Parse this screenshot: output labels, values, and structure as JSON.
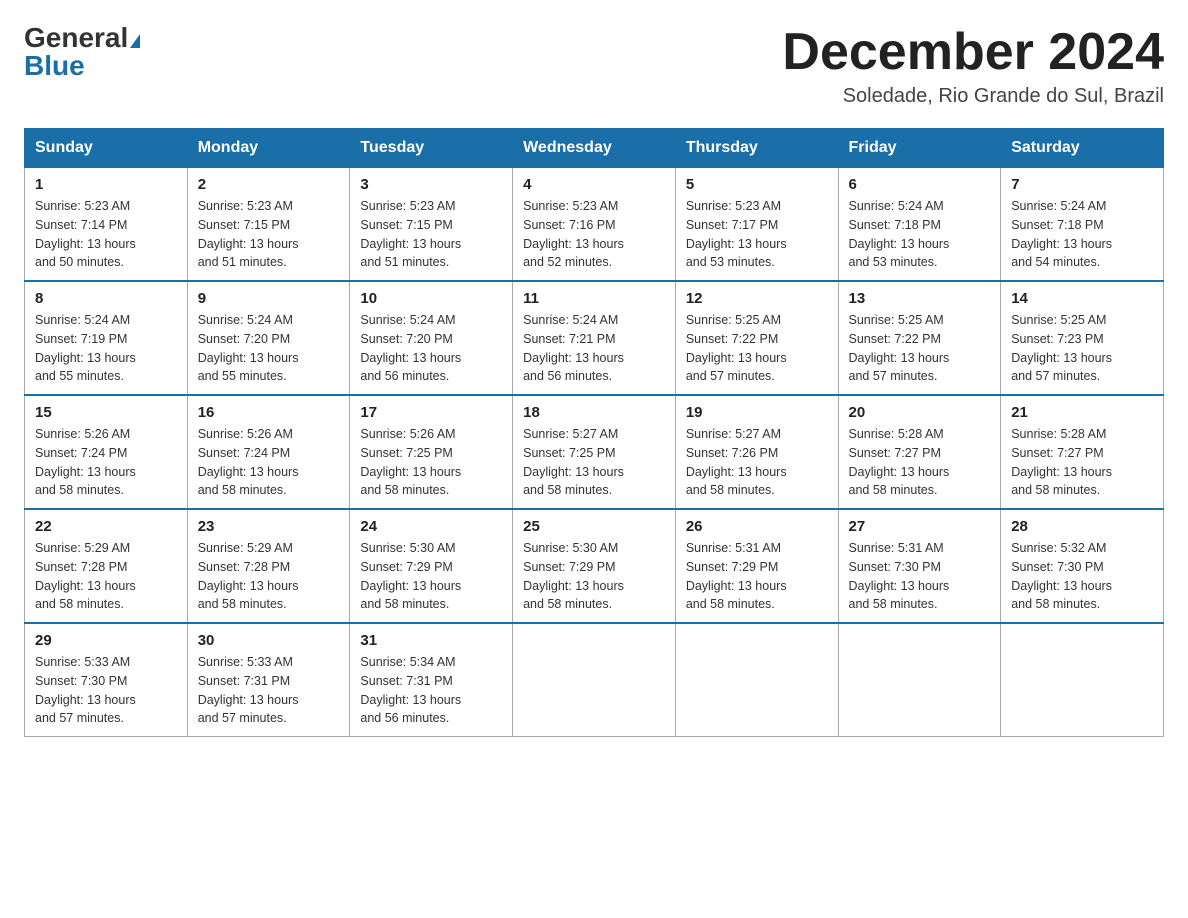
{
  "header": {
    "logo_general": "General",
    "logo_blue": "Blue",
    "month_title": "December 2024",
    "location": "Soledade, Rio Grande do Sul, Brazil"
  },
  "weekdays": [
    "Sunday",
    "Monday",
    "Tuesday",
    "Wednesday",
    "Thursday",
    "Friday",
    "Saturday"
  ],
  "weeks": [
    [
      {
        "day": "1",
        "sunrise": "5:23 AM",
        "sunset": "7:14 PM",
        "daylight": "13 hours and 50 minutes."
      },
      {
        "day": "2",
        "sunrise": "5:23 AM",
        "sunset": "7:15 PM",
        "daylight": "13 hours and 51 minutes."
      },
      {
        "day": "3",
        "sunrise": "5:23 AM",
        "sunset": "7:15 PM",
        "daylight": "13 hours and 51 minutes."
      },
      {
        "day": "4",
        "sunrise": "5:23 AM",
        "sunset": "7:16 PM",
        "daylight": "13 hours and 52 minutes."
      },
      {
        "day": "5",
        "sunrise": "5:23 AM",
        "sunset": "7:17 PM",
        "daylight": "13 hours and 53 minutes."
      },
      {
        "day": "6",
        "sunrise": "5:24 AM",
        "sunset": "7:18 PM",
        "daylight": "13 hours and 53 minutes."
      },
      {
        "day": "7",
        "sunrise": "5:24 AM",
        "sunset": "7:18 PM",
        "daylight": "13 hours and 54 minutes."
      }
    ],
    [
      {
        "day": "8",
        "sunrise": "5:24 AM",
        "sunset": "7:19 PM",
        "daylight": "13 hours and 55 minutes."
      },
      {
        "day": "9",
        "sunrise": "5:24 AM",
        "sunset": "7:20 PM",
        "daylight": "13 hours and 55 minutes."
      },
      {
        "day": "10",
        "sunrise": "5:24 AM",
        "sunset": "7:20 PM",
        "daylight": "13 hours and 56 minutes."
      },
      {
        "day": "11",
        "sunrise": "5:24 AM",
        "sunset": "7:21 PM",
        "daylight": "13 hours and 56 minutes."
      },
      {
        "day": "12",
        "sunrise": "5:25 AM",
        "sunset": "7:22 PM",
        "daylight": "13 hours and 57 minutes."
      },
      {
        "day": "13",
        "sunrise": "5:25 AM",
        "sunset": "7:22 PM",
        "daylight": "13 hours and 57 minutes."
      },
      {
        "day": "14",
        "sunrise": "5:25 AM",
        "sunset": "7:23 PM",
        "daylight": "13 hours and 57 minutes."
      }
    ],
    [
      {
        "day": "15",
        "sunrise": "5:26 AM",
        "sunset": "7:24 PM",
        "daylight": "13 hours and 58 minutes."
      },
      {
        "day": "16",
        "sunrise": "5:26 AM",
        "sunset": "7:24 PM",
        "daylight": "13 hours and 58 minutes."
      },
      {
        "day": "17",
        "sunrise": "5:26 AM",
        "sunset": "7:25 PM",
        "daylight": "13 hours and 58 minutes."
      },
      {
        "day": "18",
        "sunrise": "5:27 AM",
        "sunset": "7:25 PM",
        "daylight": "13 hours and 58 minutes."
      },
      {
        "day": "19",
        "sunrise": "5:27 AM",
        "sunset": "7:26 PM",
        "daylight": "13 hours and 58 minutes."
      },
      {
        "day": "20",
        "sunrise": "5:28 AM",
        "sunset": "7:27 PM",
        "daylight": "13 hours and 58 minutes."
      },
      {
        "day": "21",
        "sunrise": "5:28 AM",
        "sunset": "7:27 PM",
        "daylight": "13 hours and 58 minutes."
      }
    ],
    [
      {
        "day": "22",
        "sunrise": "5:29 AM",
        "sunset": "7:28 PM",
        "daylight": "13 hours and 58 minutes."
      },
      {
        "day": "23",
        "sunrise": "5:29 AM",
        "sunset": "7:28 PM",
        "daylight": "13 hours and 58 minutes."
      },
      {
        "day": "24",
        "sunrise": "5:30 AM",
        "sunset": "7:29 PM",
        "daylight": "13 hours and 58 minutes."
      },
      {
        "day": "25",
        "sunrise": "5:30 AM",
        "sunset": "7:29 PM",
        "daylight": "13 hours and 58 minutes."
      },
      {
        "day": "26",
        "sunrise": "5:31 AM",
        "sunset": "7:29 PM",
        "daylight": "13 hours and 58 minutes."
      },
      {
        "day": "27",
        "sunrise": "5:31 AM",
        "sunset": "7:30 PM",
        "daylight": "13 hours and 58 minutes."
      },
      {
        "day": "28",
        "sunrise": "5:32 AM",
        "sunset": "7:30 PM",
        "daylight": "13 hours and 58 minutes."
      }
    ],
    [
      {
        "day": "29",
        "sunrise": "5:33 AM",
        "sunset": "7:30 PM",
        "daylight": "13 hours and 57 minutes."
      },
      {
        "day": "30",
        "sunrise": "5:33 AM",
        "sunset": "7:31 PM",
        "daylight": "13 hours and 57 minutes."
      },
      {
        "day": "31",
        "sunrise": "5:34 AM",
        "sunset": "7:31 PM",
        "daylight": "13 hours and 56 minutes."
      },
      null,
      null,
      null,
      null
    ]
  ]
}
